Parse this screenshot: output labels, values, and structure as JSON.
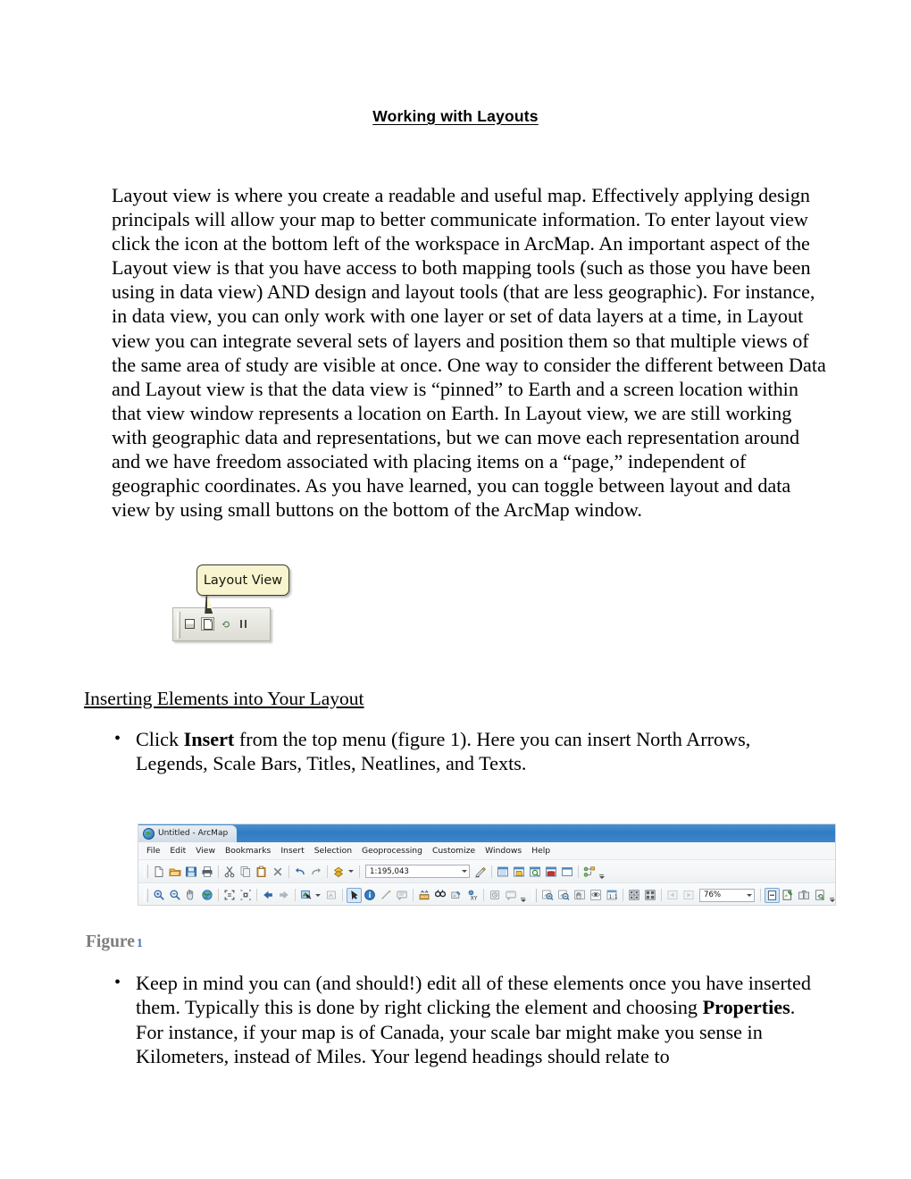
{
  "document": {
    "title": "Working with Layouts",
    "paragraph_1": "Layout view is where you create a readable and useful map. Effectively applying design principals will allow your map to better communicate information. To enter layout view click the icon at the bottom left of the workspace in ArcMap. An important aspect of the Layout view is that you have access to both mapping tools (such as those you have been using in data view) AND design and layout tools (that are less geographic). For instance, in data view, you can only work with one layer or set of data layers at a time, in Layout view you can integrate several sets of layers and position them so that multiple views of the same area of study are visible at once. One way to consider the different between Data and Layout view is that the data view is “pinned” to Earth and a screen location within that view window represents a location on Earth. In Layout view, we are still working with geographic data and representations, but we can move each representation around and we have freedom associated with placing items on a “page,” independent of geographic coordinates. As you have learned, you can toggle between layout and data view by using small buttons on the bottom of the ArcMap window.",
    "section_heading": "Inserting Elements into Your Layout",
    "bullets": [
      {
        "marker": "•",
        "segments": [
          {
            "text": "Click ",
            "bold": false
          },
          {
            "text": "Insert",
            "bold": true
          },
          {
            "text": " from the top menu (figure 1). Here you can insert North Arrows, Legends, Scale Bars, Titles, Neatlines, and Texts.",
            "bold": false
          }
        ]
      },
      {
        "marker": "•",
        "segments": [
          {
            "text": "Keep in mind you can (and should!) edit all of these elements once you have inserted them. Typically this is done by right clicking the element and choosing ",
            "bold": false
          },
          {
            "text": "Properties",
            "bold": true
          },
          {
            "text": ". For instance, if your map is of Canada, your scale bar might make you sense in Kilometers, instead of Miles. Your legend headings should relate to",
            "bold": false
          }
        ]
      }
    ],
    "figure_caption": {
      "label": "Figure",
      "number": "1",
      "label_color": "#7f7f7f",
      "number_color": "#4a77bd"
    }
  },
  "tooltip_figure": {
    "tooltip_text": "Layout View",
    "tooltip_bg": "#f7f4cf",
    "tooltip_border": "#3b3b2d",
    "buttons": [
      {
        "name": "data-view-button",
        "state": "normal"
      },
      {
        "name": "layout-view-button",
        "state": "selected"
      },
      {
        "name": "refresh-view-button",
        "state": "normal"
      },
      {
        "name": "pause-drawing-button",
        "state": "normal"
      }
    ]
  },
  "arcmap": {
    "window_title": "Untitled - ArcMap",
    "titlebar_color": "#2f7cc4",
    "menu_items": [
      "File",
      "Edit",
      "View",
      "Bookmarks",
      "Insert",
      "Selection",
      "Geoprocessing",
      "Customize",
      "Windows",
      "Help"
    ],
    "standard_toolbar": {
      "buttons": [
        "new-map",
        "open-map",
        "save-map",
        "print-map",
        "cut",
        "copy",
        "paste",
        "delete",
        "undo",
        "redo",
        "add-data"
      ],
      "scale_value": "1:195,043",
      "right_buttons": [
        "editor-toolbar",
        "table-of-contents",
        "catalog-window",
        "search-window",
        "arctoolbox",
        "python-window",
        "model-builder"
      ]
    },
    "tools_toolbar": {
      "buttons": [
        "zoom-in",
        "zoom-out",
        "pan",
        "full-extent",
        "fixed-zoom-in",
        "fixed-zoom-out",
        "go-back-extent",
        "go-forward-extent",
        "select-features",
        "clear-selected-features",
        "select-elements",
        "identify",
        "measure",
        "html-popup",
        "find-route",
        "find",
        "go-to-xy",
        "time-slider",
        "create-viewer-window"
      ]
    },
    "layout_toolbar": {
      "buttons": [
        "zoom-in-page",
        "zoom-out-page",
        "pan-page",
        "zoom-whole-page",
        "fixed-zoom-in-page",
        "zoom-100-percent",
        "zoom-to-last-extent-back",
        "zoom-to-last-extent-forward"
      ],
      "zoom_value": "76%",
      "right_buttons": [
        "toggle-draft-mode",
        "focus-data-frame",
        "change-layout",
        "data-driven-pages"
      ]
    }
  }
}
